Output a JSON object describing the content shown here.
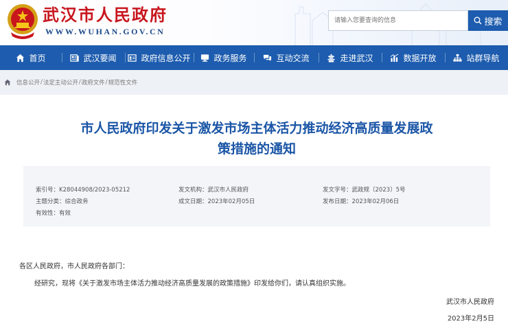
{
  "header": {
    "site_title": "武汉市人民政府",
    "site_url": "WWW.WUHAN.GOV.CN",
    "search_placeholder": "请输入您要查询的信息",
    "search_label": "搜索"
  },
  "nav": {
    "items": [
      {
        "label": "首页",
        "icon": "home-icon"
      },
      {
        "label": "武汉要闻",
        "icon": "newspaper-icon"
      },
      {
        "label": "政府信息公开",
        "icon": "info-card-icon"
      },
      {
        "label": "政务服务",
        "icon": "monitor-icon"
      },
      {
        "label": "互动交流",
        "icon": "chat-icon"
      },
      {
        "label": "走进武汉",
        "icon": "landmark-icon"
      },
      {
        "label": "数据开放",
        "icon": "bar-chart-icon"
      },
      {
        "label": "站群导航",
        "icon": "sitemap-icon"
      }
    ]
  },
  "breadcrumb": [
    "信息公开",
    "法定主动公开",
    "政府文件",
    "规范性文件"
  ],
  "document": {
    "title_line1": "市人民政府印发关于激发市场主体活力推动经济高质量发展政",
    "title_line2": "策措施的通知",
    "meta": {
      "index_label": "索引号：",
      "index_value": "K28044908/2023-05212",
      "agency_label": "发文机构：",
      "agency_value": "武汉市人民政府",
      "doc_no_label": "发文字号：",
      "doc_no_value": "武政规〔2023〕5号",
      "category_label": "主题分类：",
      "category_value": "综合政务",
      "created_label": "成文日期：",
      "created_value": "2023年02月05日",
      "published_label": "发布日期：",
      "published_value": "2023年02月06日",
      "validity_label": "有效性：",
      "validity_value": "有效"
    },
    "salutation": "各区人民政府，市人民政府各部门：",
    "body": "经研究，现将《关于激发市场主体活力推动经济高质量发展的政策措施》印发给你们，请认真组织实施。",
    "signature": "武汉市人民政府",
    "date": "2023年2月5日"
  },
  "colors": {
    "brand_blue": "#1d5cae",
    "title_red": "#c8161d",
    "heading_blue": "#1a55a6"
  }
}
